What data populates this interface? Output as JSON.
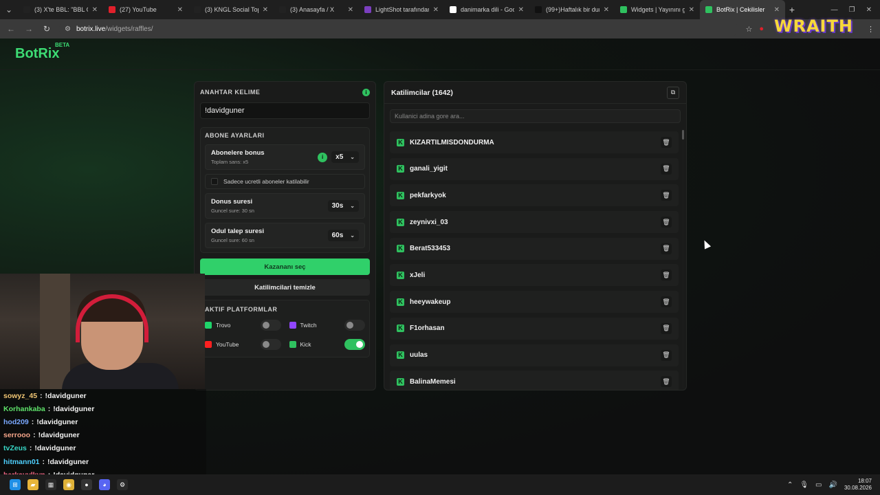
{
  "browser": {
    "tabs": [
      {
        "title": "(3) X'te BBL: \"BBL CS...",
        "icon": "x-icon",
        "color": "#222222"
      },
      {
        "title": "(27) YouTube",
        "icon": "youtube-icon",
        "color": "#e1202b"
      },
      {
        "title": "(3) KNGL Social Toplu...",
        "icon": "x-icon",
        "color": "#222222"
      },
      {
        "title": "(3) Anasayfa / X",
        "icon": "x-icon",
        "color": "#222222"
      },
      {
        "title": "LightShot tarafından...",
        "icon": "lightshot-icon",
        "color": "#7b3fbf"
      },
      {
        "title": "danimarka dili - Goo...",
        "icon": "google-icon",
        "color": "#ffffff"
      },
      {
        "title": "(99+)Haftalık bir dum...",
        "icon": "tiktok-icon",
        "color": "#111111"
      },
      {
        "title": "Widgets | Yayınını gü...",
        "icon": "botrix-icon",
        "color": "#2fc15f"
      },
      {
        "title": "BotRix | Cekilisler",
        "icon": "botrix-icon",
        "color": "#2fc15f"
      }
    ],
    "url_host": "botrix.live",
    "url_path": "/widgets/raffles/"
  },
  "overlay": {
    "brand": "WRAITH"
  },
  "site": {
    "logo": "BotRix",
    "logo_badge": "BETA"
  },
  "settings": {
    "keyword_label": "ANAHTAR KELIME",
    "keyword_value": "!davidguner",
    "subscriber_section": "ABONE AYARLARI",
    "bonus_title": "Abonelere bonus",
    "bonus_sub": "Toplam sans: x5",
    "bonus_value": "x5",
    "only_paid_label": "Sadece ucretli aboneler katilabilir",
    "bonus_duration_title": "Donus suresi",
    "bonus_duration_sub": "Guncel sure: 30 sn",
    "bonus_duration_value": "30s",
    "claim_title": "Odul talep suresi",
    "claim_sub": "Guncel sure: 60 sn",
    "claim_value": "60s",
    "pick_winner": "Kazananı seç",
    "clear_participants": "Katilimcilari temizle",
    "platforms_label": "AKTIF PLATFORMLAR",
    "platforms": [
      {
        "name": "Trovo",
        "color": "#1fd46a",
        "on": false
      },
      {
        "name": "Twitch",
        "color": "#9146ff",
        "on": false
      },
      {
        "name": "YouTube",
        "color": "#ff2020",
        "on": false
      },
      {
        "name": "Kick",
        "color": "#2fc15f",
        "on": true
      }
    ]
  },
  "participants": {
    "title": "Katilimcilar (1642)",
    "search_placeholder": "Kullanici adina gore ara...",
    "items": [
      "KIZARTILMISDONDURMA",
      "ganali_yigit",
      "pekfarkyok",
      "zeynivxi_03",
      "Berat533453",
      "xJeli",
      "heeywakeup",
      "F1orhasan",
      "uulas",
      "BalinaMemesi"
    ]
  },
  "chat": [
    {
      "user": "sowyz_45",
      "color": "#f0c674",
      "msg": "!davidguner"
    },
    {
      "user": "Korhankaba",
      "color": "#5fe36b",
      "msg": "!davidguner"
    },
    {
      "user": "hod209",
      "color": "#7aa8ff",
      "msg": "!davidguner"
    },
    {
      "user": "serrooo",
      "color": "#f5a58a",
      "msg": "!davidguner"
    },
    {
      "user": "tvZeus",
      "color": "#38d8c8",
      "msg": "!davidguner"
    },
    {
      "user": "hitmann01",
      "color": "#4fd1ff",
      "msg": "!davidguner"
    },
    {
      "user": "berkayylkvn",
      "color": "#ff6b8a",
      "msg": "!davidguner"
    }
  ],
  "taskbar": {
    "time": "18:07",
    "date": "30.08.2026"
  }
}
